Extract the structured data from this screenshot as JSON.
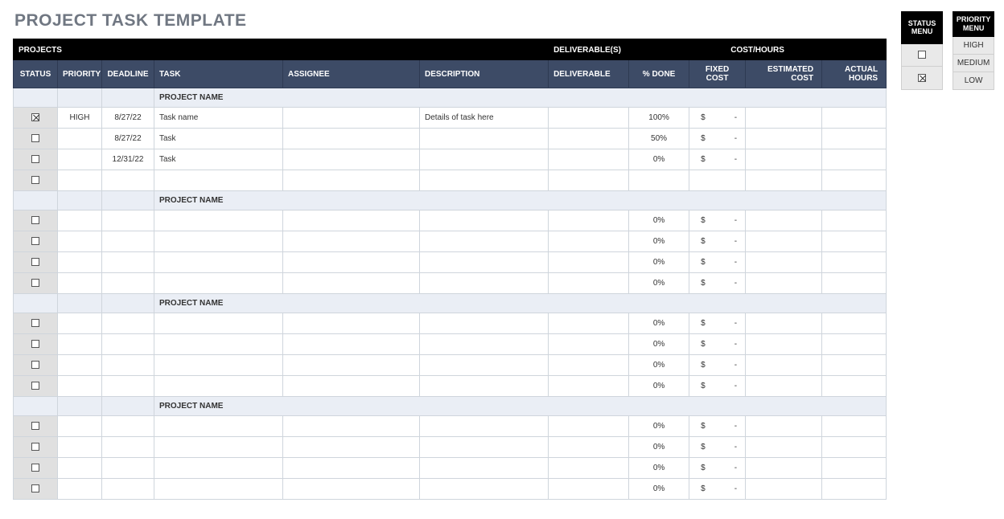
{
  "title": "PROJECT TASK TEMPLATE",
  "band": {
    "projects": "PROJECTS",
    "deliverables": "DELIVERABLE(S)",
    "cost_hours": "COST/HOURS"
  },
  "columns": {
    "status": "STATUS",
    "priority": "PRIORITY",
    "deadline": "DEADLINE",
    "task": "TASK",
    "assignee": "ASSIGNEE",
    "description": "DESCRIPTION",
    "deliverable": "DELIVERABLE",
    "pct_done": "% DONE",
    "fixed_cost": "FIXED COST",
    "est_cost": "ESTIMATED COST",
    "actual_hours": "ACTUAL HOURS"
  },
  "project_header_label": "PROJECT NAME",
  "fixed_currency": "$",
  "fixed_dash": "-",
  "groups": [
    {
      "rows": [
        {
          "status_checked": true,
          "priority": "HIGH",
          "deadline": "8/27/22",
          "task": "Task name",
          "assignee": "",
          "description": "Details of task here",
          "deliverable": "",
          "pct_done": "100%",
          "show_fixed": true
        },
        {
          "status_checked": false,
          "priority": "",
          "deadline": "8/27/22",
          "task": "Task",
          "assignee": "",
          "description": "",
          "deliverable": "",
          "pct_done": "50%",
          "show_fixed": true
        },
        {
          "status_checked": false,
          "priority": "",
          "deadline": "12/31/22",
          "task": "Task",
          "assignee": "",
          "description": "",
          "deliverable": "",
          "pct_done": "0%",
          "show_fixed": true
        },
        {
          "status_checked": false,
          "priority": "",
          "deadline": "",
          "task": "",
          "assignee": "",
          "description": "",
          "deliverable": "",
          "pct_done": "",
          "show_fixed": false
        }
      ]
    },
    {
      "rows": [
        {
          "status_checked": false,
          "priority": "",
          "deadline": "",
          "task": "",
          "assignee": "",
          "description": "",
          "deliverable": "",
          "pct_done": "0%",
          "show_fixed": true
        },
        {
          "status_checked": false,
          "priority": "",
          "deadline": "",
          "task": "",
          "assignee": "",
          "description": "",
          "deliverable": "",
          "pct_done": "0%",
          "show_fixed": true
        },
        {
          "status_checked": false,
          "priority": "",
          "deadline": "",
          "task": "",
          "assignee": "",
          "description": "",
          "deliverable": "",
          "pct_done": "0%",
          "show_fixed": true
        },
        {
          "status_checked": false,
          "priority": "",
          "deadline": "",
          "task": "",
          "assignee": "",
          "description": "",
          "deliverable": "",
          "pct_done": "0%",
          "show_fixed": true
        }
      ]
    },
    {
      "rows": [
        {
          "status_checked": false,
          "priority": "",
          "deadline": "",
          "task": "",
          "assignee": "",
          "description": "",
          "deliverable": "",
          "pct_done": "0%",
          "show_fixed": true
        },
        {
          "status_checked": false,
          "priority": "",
          "deadline": "",
          "task": "",
          "assignee": "",
          "description": "",
          "deliverable": "",
          "pct_done": "0%",
          "show_fixed": true
        },
        {
          "status_checked": false,
          "priority": "",
          "deadline": "",
          "task": "",
          "assignee": "",
          "description": "",
          "deliverable": "",
          "pct_done": "0%",
          "show_fixed": true
        },
        {
          "status_checked": false,
          "priority": "",
          "deadline": "",
          "task": "",
          "assignee": "",
          "description": "",
          "deliverable": "",
          "pct_done": "0%",
          "show_fixed": true
        }
      ]
    },
    {
      "rows": [
        {
          "status_checked": false,
          "priority": "",
          "deadline": "",
          "task": "",
          "assignee": "",
          "description": "",
          "deliverable": "",
          "pct_done": "0%",
          "show_fixed": true
        },
        {
          "status_checked": false,
          "priority": "",
          "deadline": "",
          "task": "",
          "assignee": "",
          "description": "",
          "deliverable": "",
          "pct_done": "0%",
          "show_fixed": true
        },
        {
          "status_checked": false,
          "priority": "",
          "deadline": "",
          "task": "",
          "assignee": "",
          "description": "",
          "deliverable": "",
          "pct_done": "0%",
          "show_fixed": true
        },
        {
          "status_checked": false,
          "priority": "",
          "deadline": "",
          "task": "",
          "assignee": "",
          "description": "",
          "deliverable": "",
          "pct_done": "0%",
          "show_fixed": true
        }
      ]
    }
  ],
  "status_menu": {
    "title": "STATUS MENU",
    "options": [
      {
        "checked": false
      },
      {
        "checked": true
      }
    ]
  },
  "priority_menu": {
    "title": "PRIORITY MENU",
    "options": [
      "HIGH",
      "MEDIUM",
      "LOW"
    ]
  }
}
